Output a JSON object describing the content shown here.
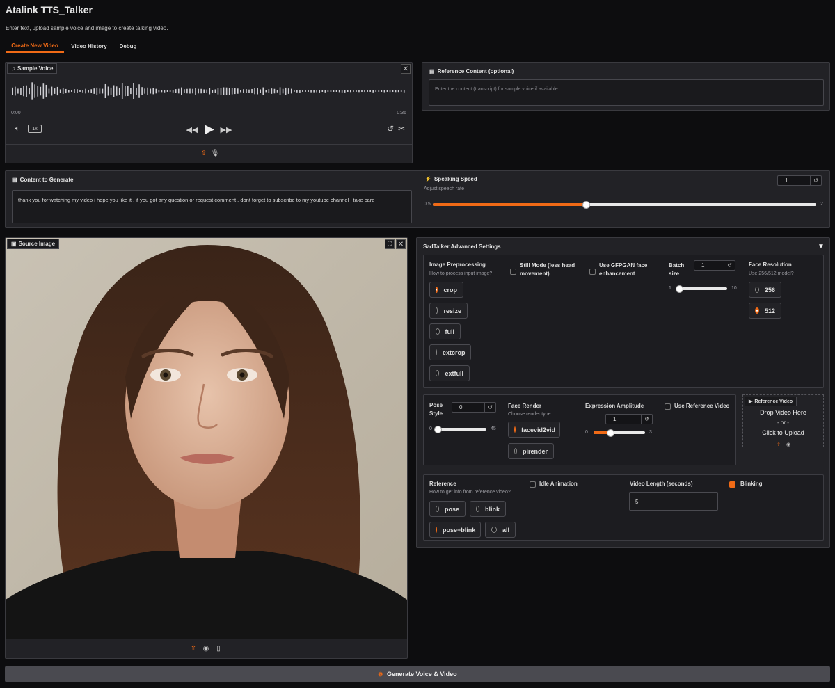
{
  "app": {
    "title": "Atalink TTS_Talker",
    "subtitle": "Enter text, upload sample voice and image to create talking video."
  },
  "tabs": [
    {
      "label": "Create New Video",
      "active": true
    },
    {
      "label": "Video History"
    },
    {
      "label": "Debug"
    }
  ],
  "sample_voice": {
    "label": "Sample Voice",
    "time_start": "0:00",
    "time_end": "0:36",
    "speed": "1x"
  },
  "reference_content": {
    "label": "Reference Content (optional)",
    "placeholder": "Enter the content (transcript) for sample voice if available..."
  },
  "content_to_generate": {
    "label": "Content to Generate",
    "value": "thank you for watching my video i hope you like it . if you got any question or request comment . dont forget to subscribe to my youtube channel . take care"
  },
  "speaking_speed": {
    "label": "Speaking Speed",
    "desc": "Adjust speech rate",
    "value": "1",
    "min": "0.5",
    "max": "2",
    "level": 0.4
  },
  "source_image": {
    "label": "Source Image"
  },
  "advanced": {
    "title": "SadTalker Advanced Settings",
    "preprocess": {
      "label": "Image Preprocessing",
      "desc": "How to process input image?",
      "options": [
        "crop",
        "resize",
        "full",
        "extcrop",
        "extfull"
      ],
      "selected": "crop"
    },
    "still_mode": {
      "label": "Still Mode (less head movement)",
      "checked": false
    },
    "gfpgan": {
      "label": "Use GFPGAN face enhancement",
      "checked": false
    },
    "batch": {
      "label": "Batch size",
      "value": "1",
      "min": "1",
      "max": "10",
      "level": 0.05
    },
    "face_res": {
      "label": "Face Resolution",
      "desc": "Use 256/512 model?",
      "options": [
        "256",
        "512"
      ],
      "selected": "512"
    },
    "pose": {
      "label": "Pose Style",
      "value": "0",
      "min": "0",
      "max": "45",
      "level": 0
    },
    "face_render": {
      "label": "Face Render",
      "desc": "Choose render type",
      "options": [
        "facevid2vid",
        "pirender"
      ],
      "selected": "facevid2vid"
    },
    "expr": {
      "label": "Expression Amplitude",
      "value": "1",
      "min": "0",
      "max": "3",
      "level": 0.33
    },
    "use_ref_video": {
      "label": "Use Reference Video",
      "checked": false
    },
    "ref_video": {
      "label": "Reference Video",
      "drop": "Drop Video Here",
      "or": "- or -",
      "click": "Click to Upload"
    },
    "reference": {
      "label": "Reference",
      "desc": "How to get info from reference video?",
      "options": [
        "pose",
        "blink",
        "pose+blink",
        "all"
      ],
      "selected": "pose+blink"
    },
    "idle": {
      "label": "Idle Animation",
      "checked": false
    },
    "video_length": {
      "label": "Video Length (seconds)",
      "value": "5"
    },
    "blinking": {
      "label": "Blinking",
      "checked": true
    }
  },
  "generate": {
    "label": "Generate Voice & Video"
  },
  "colors": {
    "accent": "#f06a16",
    "panel": "#222226",
    "bg": "#0d0d0f"
  }
}
